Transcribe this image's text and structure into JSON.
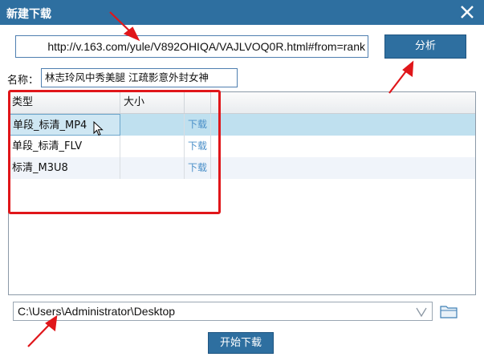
{
  "window": {
    "title": "新建下载",
    "close_icon": "close-icon"
  },
  "url": {
    "value": "http://v.163.com/yule/V892OHIQA/VAJLVOQ0R.html#from=rank"
  },
  "analyze_button": {
    "label": "分析"
  },
  "name": {
    "label": "名称：",
    "value": "林志玲风中秀美腿 江疏影意外封女神"
  },
  "table": {
    "columns": [
      "类型",
      "大小",
      ""
    ],
    "rows": [
      {
        "type": "单段_标清_MP4",
        "size": "",
        "action": "下载",
        "selected": true
      },
      {
        "type": "单段_标清_FLV",
        "size": "",
        "action": "下载",
        "selected": false
      },
      {
        "type": "标清_M3U8",
        "size": "",
        "action": "下载",
        "selected": false
      }
    ]
  },
  "save_path": {
    "value": "C:\\Users\\Administrator\\Desktop"
  },
  "start_button": {
    "label": "开始下载"
  },
  "colors": {
    "titlebar": "#2e6fa0",
    "selection": "#bfe0ef",
    "highlight": "#e0161a",
    "link": "#4a8fc8"
  }
}
